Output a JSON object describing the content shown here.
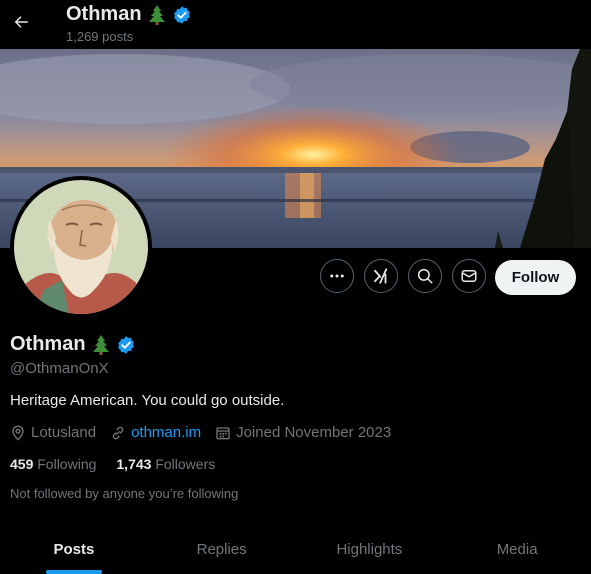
{
  "header": {
    "name": "Othman",
    "posts": "1,269 posts"
  },
  "profile": {
    "name": "Othman",
    "handle": "@OthmanOnX",
    "bio": "Heritage American. You could go outside.",
    "location": "Lotusland",
    "website": "othman.im",
    "joined": "Joined November 2023",
    "following_count": "459",
    "following_label": "Following",
    "followers_count": "1,743",
    "followers_label": "Followers",
    "not_followed": "Not followed by anyone you’re following"
  },
  "actions": {
    "follow_label": "Follow"
  },
  "tabs": [
    {
      "label": "Posts",
      "active": true
    },
    {
      "label": "Replies",
      "active": false
    },
    {
      "label": "Highlights",
      "active": false
    },
    {
      "label": "Media",
      "active": false
    }
  ],
  "colors": {
    "accent": "#1d9bf0",
    "background": "#000000",
    "muted": "#71767b",
    "verified": "#1d9bf0"
  },
  "icons": [
    "back-arrow-icon",
    "tree-emoji",
    "verified-badge-icon",
    "more-icon",
    "grok-icon",
    "search-icon",
    "message-icon",
    "location-icon",
    "link-icon",
    "calendar-icon"
  ]
}
